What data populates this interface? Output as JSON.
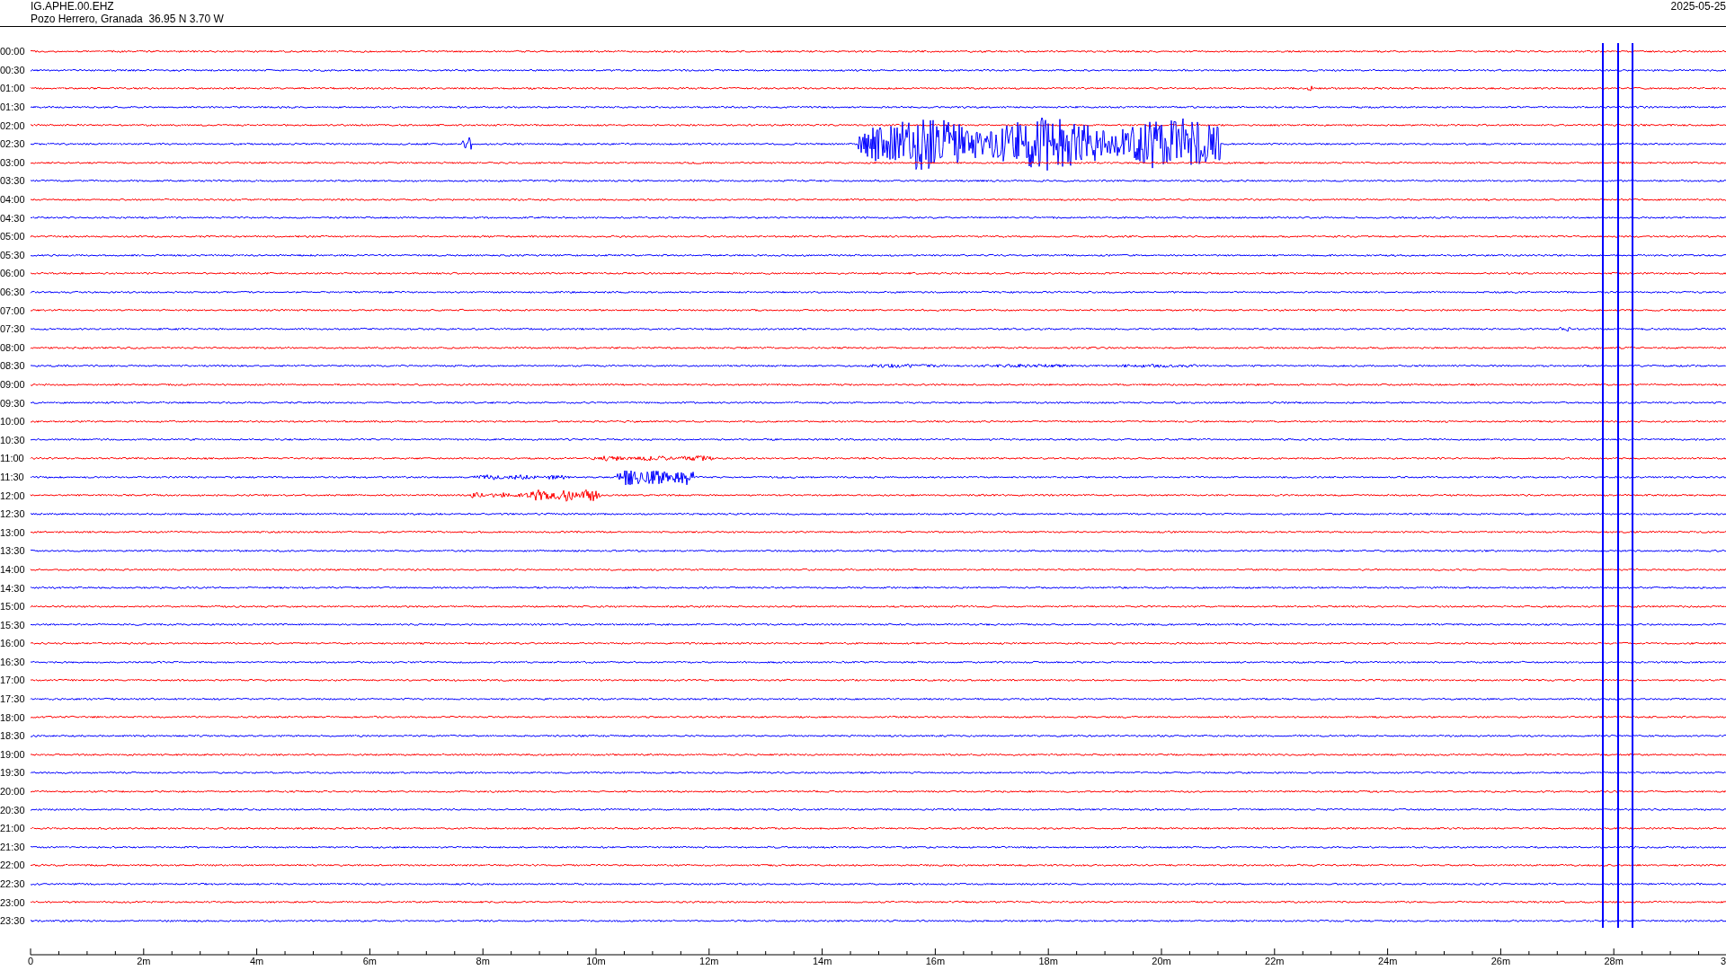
{
  "header": {
    "station": "IG.APHE.00.EHZ",
    "location": "Pozo Herrero, Granada  36.95 N 3.70 W",
    "date": "2025-05-25"
  },
  "traces": [
    {
      "label": "00:00",
      "color": "#ff0000"
    },
    {
      "label": "00:30",
      "color": "#0000ff"
    },
    {
      "label": "01:00",
      "color": "#ff0000"
    },
    {
      "label": "01:30",
      "color": "#0000ff"
    },
    {
      "label": "02:00",
      "color": "#ff0000"
    },
    {
      "label": "02:30",
      "color": "#0000ff"
    },
    {
      "label": "03:00",
      "color": "#ff0000"
    },
    {
      "label": "03:30",
      "color": "#0000ff"
    },
    {
      "label": "04:00",
      "color": "#ff0000"
    },
    {
      "label": "04:30",
      "color": "#0000ff"
    },
    {
      "label": "05:00",
      "color": "#ff0000"
    },
    {
      "label": "05:30",
      "color": "#0000ff"
    },
    {
      "label": "06:00",
      "color": "#ff0000"
    },
    {
      "label": "06:30",
      "color": "#0000ff"
    },
    {
      "label": "07:00",
      "color": "#ff0000"
    },
    {
      "label": "07:30",
      "color": "#0000ff"
    },
    {
      "label": "08:00",
      "color": "#ff0000"
    },
    {
      "label": "08:30",
      "color": "#0000ff"
    },
    {
      "label": "09:00",
      "color": "#ff0000"
    },
    {
      "label": "09:30",
      "color": "#0000ff"
    },
    {
      "label": "10:00",
      "color": "#ff0000"
    },
    {
      "label": "10:30",
      "color": "#0000ff"
    },
    {
      "label": "11:00",
      "color": "#ff0000"
    },
    {
      "label": "11:30",
      "color": "#0000ff"
    },
    {
      "label": "12:00",
      "color": "#ff0000"
    },
    {
      "label": "12:30",
      "color": "#0000ff"
    },
    {
      "label": "13:00",
      "color": "#ff0000"
    },
    {
      "label": "13:30",
      "color": "#0000ff"
    },
    {
      "label": "14:00",
      "color": "#ff0000"
    },
    {
      "label": "14:30",
      "color": "#0000ff"
    },
    {
      "label": "15:00",
      "color": "#ff0000"
    },
    {
      "label": "15:30",
      "color": "#0000ff"
    },
    {
      "label": "16:00",
      "color": "#ff0000"
    },
    {
      "label": "16:30",
      "color": "#0000ff"
    },
    {
      "label": "17:00",
      "color": "#ff0000"
    },
    {
      "label": "17:30",
      "color": "#0000ff"
    },
    {
      "label": "18:00",
      "color": "#ff0000"
    },
    {
      "label": "18:30",
      "color": "#0000ff"
    },
    {
      "label": "19:00",
      "color": "#ff0000"
    },
    {
      "label": "19:30",
      "color": "#0000ff"
    },
    {
      "label": "20:00",
      "color": "#ff0000"
    },
    {
      "label": "20:30",
      "color": "#0000ff"
    },
    {
      "label": "21:00",
      "color": "#ff0000"
    },
    {
      "label": "21:30",
      "color": "#0000ff"
    },
    {
      "label": "22:00",
      "color": "#ff0000"
    },
    {
      "label": "22:30",
      "color": "#0000ff"
    },
    {
      "label": "23:00",
      "color": "#ff0000"
    },
    {
      "label": "23:30",
      "color": "#0000ff"
    }
  ],
  "axis": {
    "ticks": [
      "0",
      "2m",
      "4m",
      "6m",
      "8m",
      "10m",
      "12m",
      "14m",
      "16m",
      "18m",
      "20m",
      "22m",
      "24m",
      "26m",
      "28m",
      "3"
    ]
  }
}
